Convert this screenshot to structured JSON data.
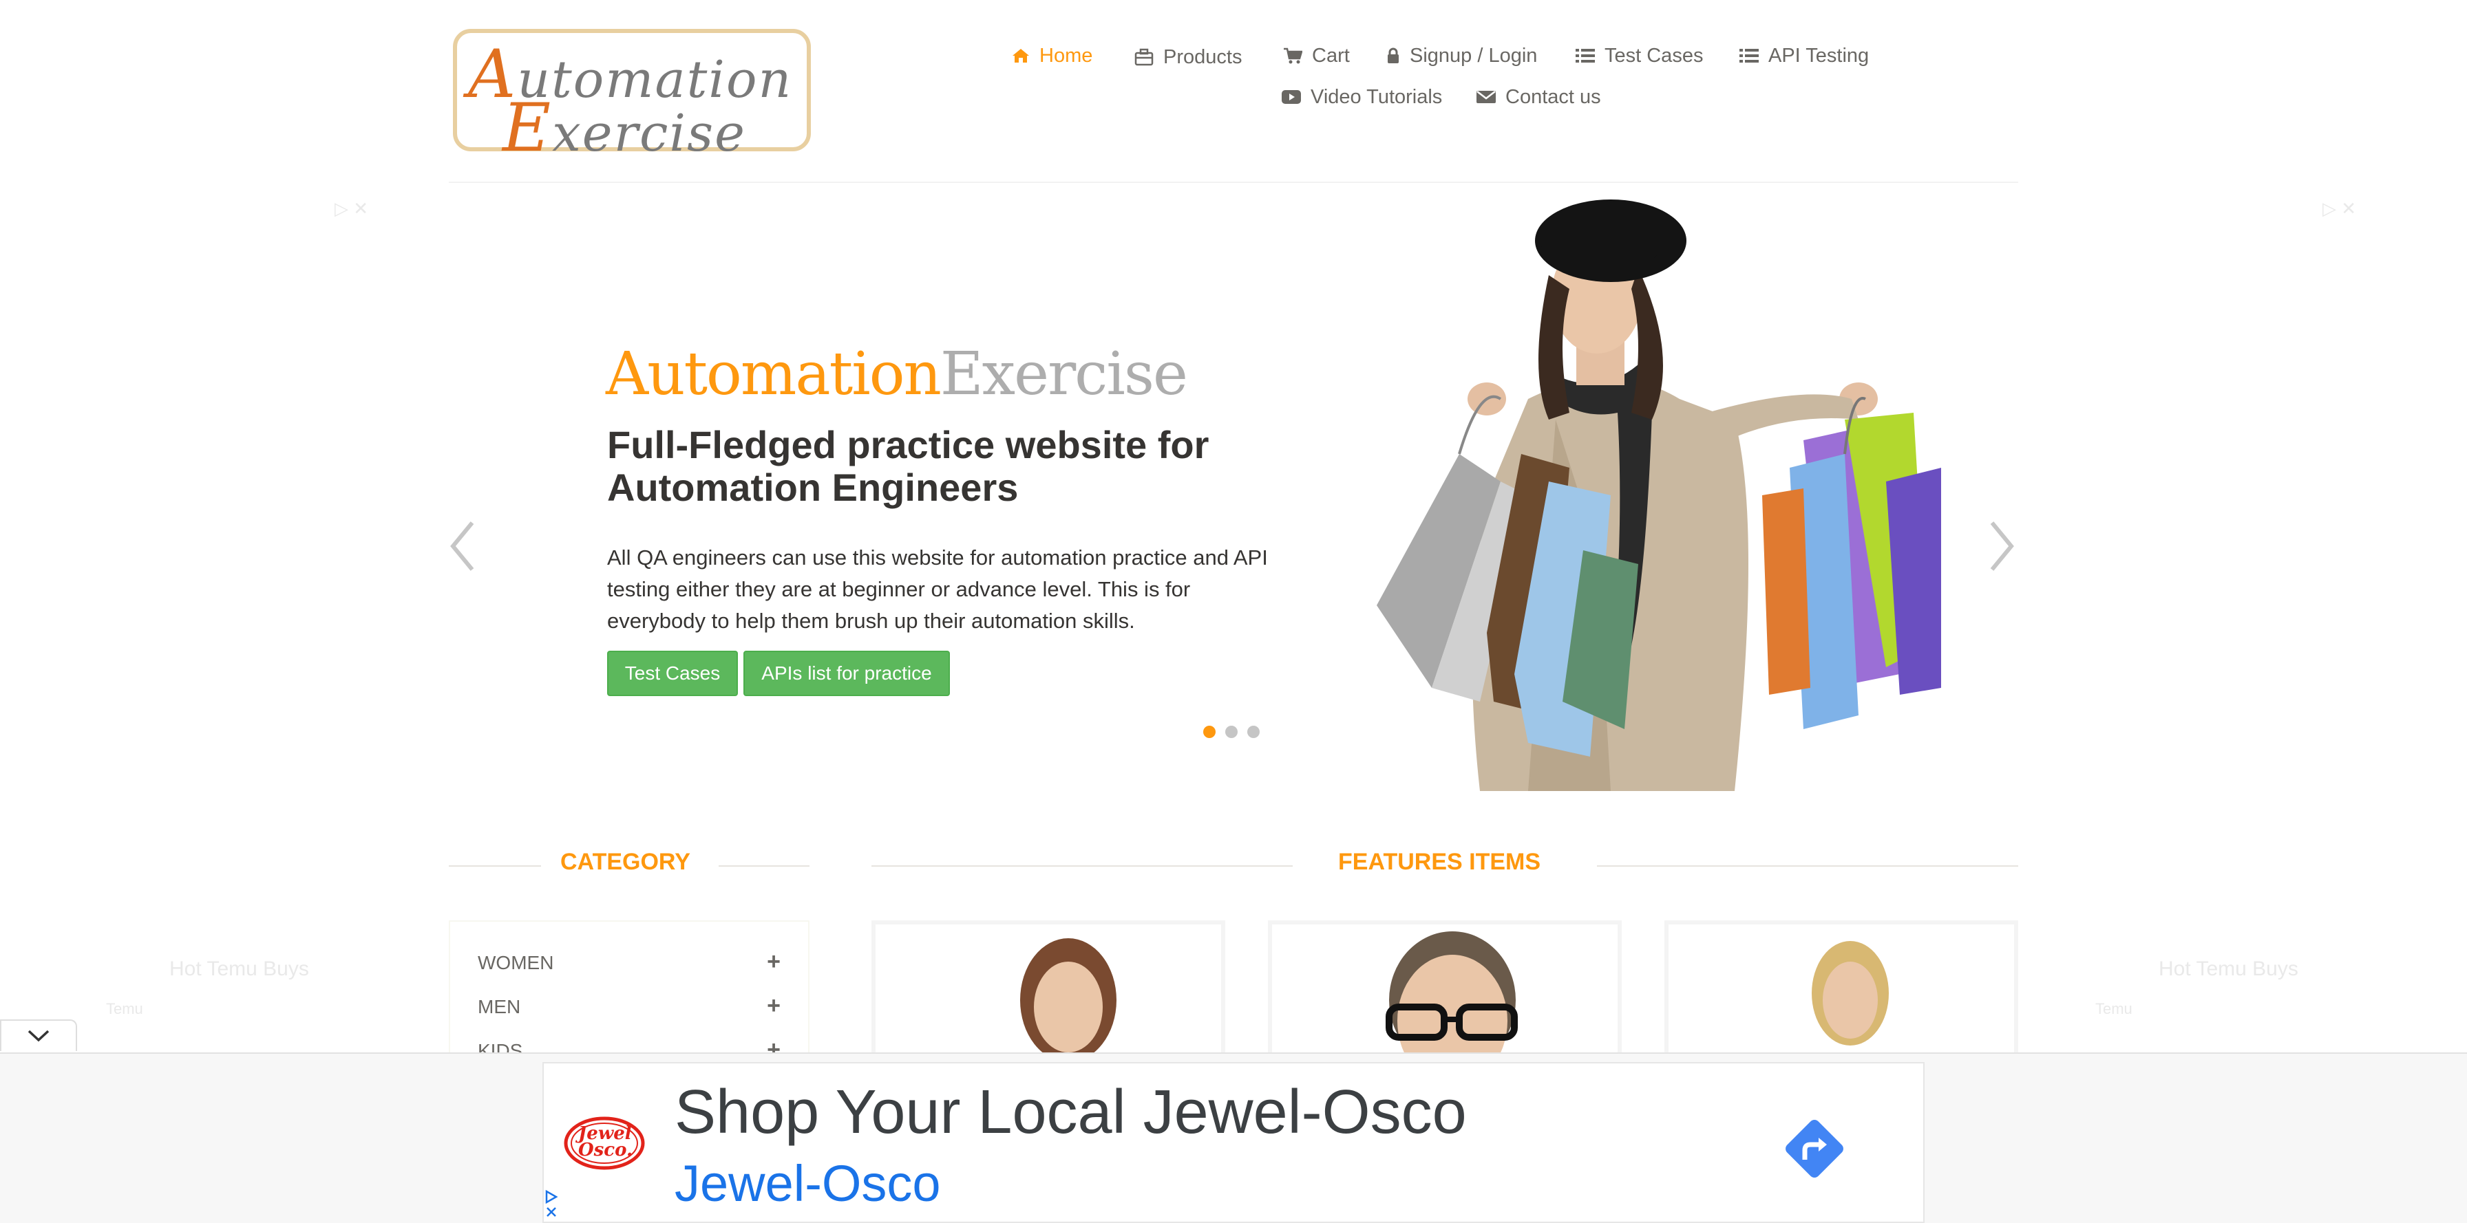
{
  "logo": {
    "line1_first": "A",
    "line1_rest": "utomation",
    "line2_first": "E",
    "line2_rest": "xercise"
  },
  "nav": {
    "home": "Home",
    "products": "Products",
    "cart": "Cart",
    "login": "Signup / Login",
    "test_cases": "Test Cases",
    "api_testing": "API Testing",
    "video_tutorials": "Video Tutorials",
    "contact": "Contact us",
    "icons": [
      "home-icon",
      "products-icon",
      "cart-icon",
      "lock-icon",
      "list-icon",
      "list-icon",
      "youtube-icon",
      "envelope-icon"
    ]
  },
  "slider": {
    "brand_a": "Automation",
    "brand_b": "Exercise",
    "heading": "Full-Fledged practice website for Automation Engineers",
    "text": "All QA engineers can use this website for automation practice and API testing either they are at beginner or advance level. This is for everybody to help them brush up their automation skills.",
    "btn_test_cases": "Test Cases",
    "btn_apis": "APIs list for practice",
    "active_slide": 1,
    "slide_count": 3
  },
  "category": {
    "title": "Category",
    "items": [
      {
        "label": "WOMEN",
        "toggle": "+"
      },
      {
        "label": "MEN",
        "toggle": "+"
      },
      {
        "label": "KIDS",
        "toggle": "+"
      }
    ]
  },
  "features": {
    "title": "Features Items"
  },
  "side_ads": {
    "left": "Hot Temu Buys",
    "right": "Hot Temu Buys",
    "left_sub": "Temu",
    "right_sub": "Temu"
  },
  "ad": {
    "title": "Shop Your Local Jewel-Osco",
    "advertiser": "Jewel-Osco",
    "logo_text_1": "Jewel",
    "logo_text_2": "Osco."
  },
  "colors": {
    "accent": "#fe980f",
    "button_green": "#5cb85c",
    "ad_link": "#1a73e8",
    "ad_logo_red": "#e2231a"
  }
}
